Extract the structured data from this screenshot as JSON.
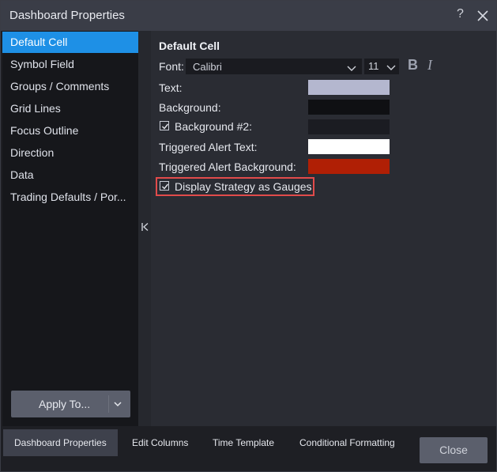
{
  "window": {
    "title": "Dashboard Properties",
    "help_label": "?"
  },
  "sidebar": {
    "items": [
      {
        "label": "Default Cell",
        "active": true
      },
      {
        "label": "Symbol Field",
        "active": false
      },
      {
        "label": "Groups / Comments",
        "active": false
      },
      {
        "label": "Grid Lines",
        "active": false
      },
      {
        "label": "Focus Outline",
        "active": false
      },
      {
        "label": "Direction",
        "active": false
      },
      {
        "label": "Data",
        "active": false
      },
      {
        "label": "Trading Defaults / Por...",
        "active": false
      }
    ],
    "apply_button": "Apply To..."
  },
  "main": {
    "section_title": "Default Cell",
    "font_label": "Font:",
    "font_value": "Calibri",
    "size_value": "11",
    "bold_label": "B",
    "italic_label": "I",
    "text_label": "Text:",
    "text_color": "#b4b7cf",
    "background_label": "Background:",
    "background_color": "#0f1013",
    "background2_label": "Background #2:",
    "background2_checked": true,
    "background2_color": "#1b1c22",
    "alert_text_label": "Triggered Alert Text:",
    "alert_text_color": "#ffffff",
    "alert_bg_label": "Triggered Alert Background:",
    "alert_bg_color": "#b01f05",
    "gauges_label": "Display Strategy as Gauges",
    "gauges_checked": true
  },
  "bottom": {
    "tabs": [
      {
        "label": "Dashboard Properties",
        "active": true
      },
      {
        "label": "Edit Columns",
        "active": false
      },
      {
        "label": "Time Template",
        "active": false
      },
      {
        "label": "Conditional Formatting",
        "active": false
      }
    ],
    "close_button": "Close"
  },
  "colors": {
    "accent": "#1e90e6",
    "highlight_border": "#e14b4b"
  }
}
